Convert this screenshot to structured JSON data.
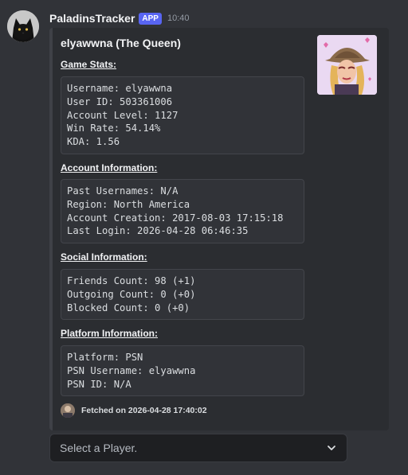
{
  "message": {
    "author": "PaladinsTracker",
    "badge": "APP",
    "timestamp": "10:40",
    "avatar_icon": "black-cat-avatar"
  },
  "embed": {
    "title": "elyawwna (The Queen)",
    "thumbnail_icon": "champion-portrait-cowgirl",
    "sections": [
      {
        "title": "Game Stats:",
        "lines": [
          "Username: elyawwna",
          "User ID: 503361006",
          "Account Level: 1127",
          "Win Rate: 54.14%",
          "KDA: 1.56"
        ]
      },
      {
        "title": "Account Information:",
        "lines": [
          "Past Usernames: N/A",
          "Region: North America",
          "Account Creation: 2017-08-03 17:15:18",
          "Last Login: 2026-04-28 06:46:35"
        ]
      },
      {
        "title": "Social Information:",
        "lines": [
          "Friends Count: 98 (+1)",
          "Outgoing Count: 0 (+0)",
          "Blocked Count: 0 (+0)"
        ]
      },
      {
        "title": "Platform Information:",
        "lines": [
          "Platform: PSN",
          "PSN Username: elyawwna",
          "PSN ID: N/A"
        ]
      }
    ],
    "footer": {
      "text": "Fetched on 2026-04-28 17:40:02",
      "icon": "bot-icon"
    }
  },
  "select": {
    "placeholder": "Select a Player."
  },
  "colors": {
    "background": "#313338",
    "embed_background": "#2b2d31",
    "embed_border": "#3f4147",
    "badge": "#5865f2"
  }
}
